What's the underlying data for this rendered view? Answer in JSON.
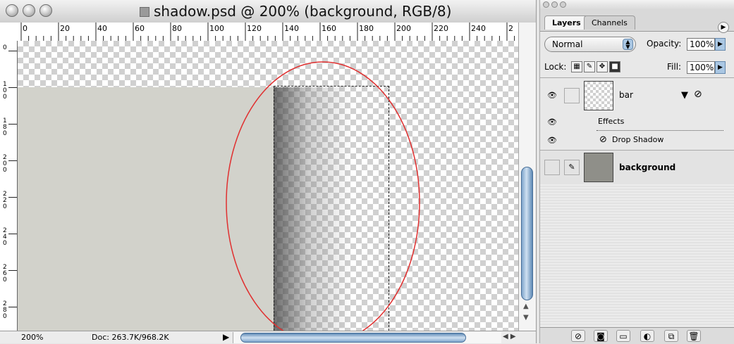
{
  "window": {
    "title": "shadow.psd @ 200% (background, RGB/8)"
  },
  "ruler": {
    "h_ticks": [
      "0",
      "20",
      "40",
      "60",
      "80",
      "100",
      "120",
      "140",
      "160",
      "180",
      "200",
      "220",
      "240",
      "2"
    ],
    "v_ticks": [
      "0",
      "100",
      "180",
      "200",
      "220",
      "240",
      "260",
      "280"
    ]
  },
  "status": {
    "zoom": "200%",
    "doc": "Doc: 263.7K/968.2K"
  },
  "layers_panel": {
    "tabs": [
      "Layers",
      "Channels"
    ],
    "blend_mode": "Normal",
    "opacity_label": "Opacity:",
    "opacity_value": "100%",
    "lock_label": "Lock:",
    "fill_label": "Fill:",
    "fill_value": "100%",
    "layers": [
      {
        "name": "bar",
        "effects_label": "Effects",
        "effect": "Drop Shadow"
      },
      {
        "name": "background"
      }
    ]
  },
  "colors": {
    "background_layer": "#d2d2cb",
    "annotation_oval": "#e03030",
    "scroll_thumb": "#7fa5cc"
  }
}
